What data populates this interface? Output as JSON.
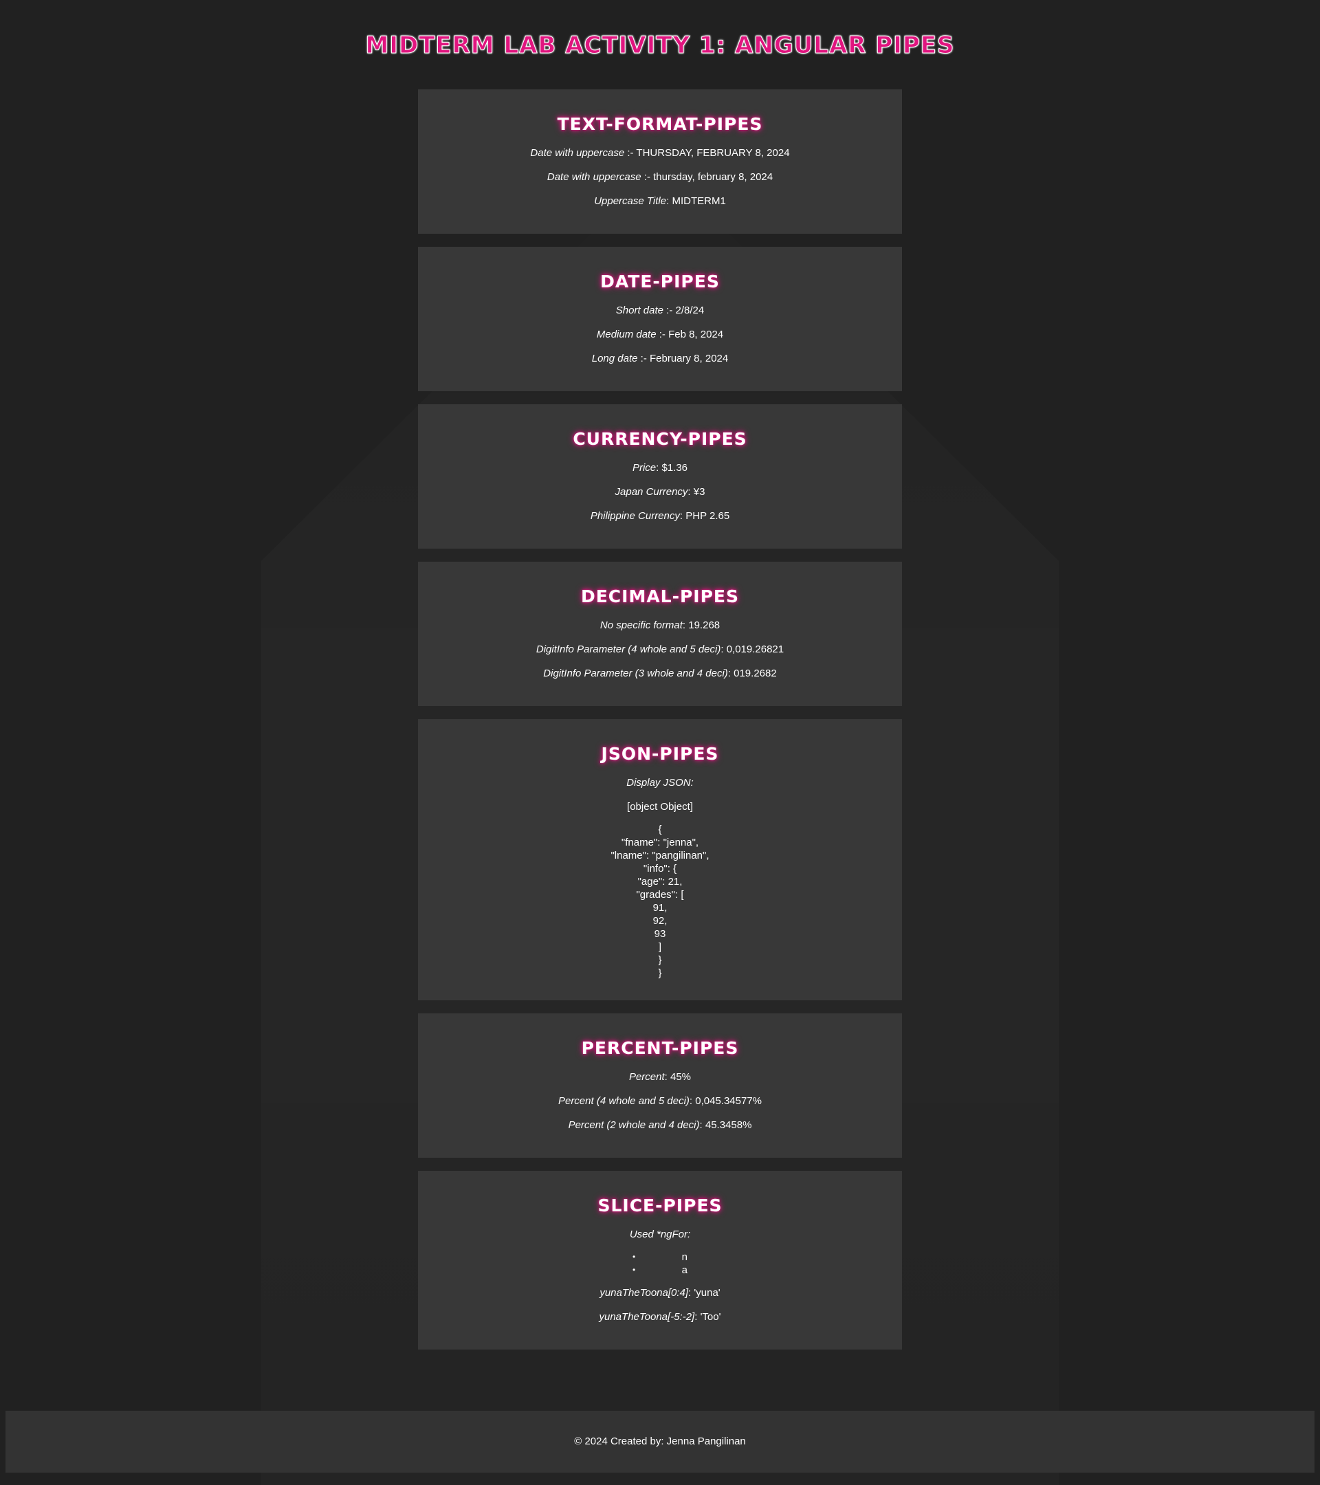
{
  "page": {
    "title": "MIDTERM LAB ACTIVITY 1: ANGULAR PIPES"
  },
  "cards": {
    "text_format": {
      "title": "TEXT-FORMAT-PIPES",
      "rows": [
        {
          "label": "Date with uppercase",
          "sep": " :- ",
          "value": "THURSDAY, FEBRUARY 8, 2024"
        },
        {
          "label": "Date with uppercase",
          "sep": " :- ",
          "value": "thursday, february 8, 2024"
        },
        {
          "label": "Uppercase Title",
          "sep": ": ",
          "value": "MIDTERM1"
        }
      ]
    },
    "date": {
      "title": "DATE-PIPES",
      "rows": [
        {
          "label": "Short date",
          "sep": " :- ",
          "value": "2/8/24"
        },
        {
          "label": "Medium date",
          "sep": " :- ",
          "value": "Feb 8, 2024"
        },
        {
          "label": "Long date",
          "sep": " :- ",
          "value": "February 8, 2024"
        }
      ]
    },
    "currency": {
      "title": "CURRENCY-PIPES",
      "rows": [
        {
          "label": "Price",
          "sep": ": ",
          "value": "$1.36"
        },
        {
          "label": "Japan Currency",
          "sep": ": ",
          "value": "¥3"
        },
        {
          "label": "Philippine Currency",
          "sep": ": ",
          "value": "PHP 2.65"
        }
      ]
    },
    "decimal": {
      "title": "DECIMAL-PIPES",
      "rows": [
        {
          "label": "No specific format",
          "sep": ": ",
          "value": "19.268"
        },
        {
          "label": "DigitInfo Parameter (4 whole and 5 deci)",
          "sep": ": ",
          "value": "0,019.26821"
        },
        {
          "label": "DigitInfo Parameter (3 whole and 4 deci)",
          "sep": ": ",
          "value": "019.2682"
        }
      ]
    },
    "json": {
      "title": "JSON-PIPES",
      "label": "Display JSON:",
      "object_text": "[object Object]",
      "json_text": "{\n\"fname\": \"jenna\",\n\"lname\": \"pangilinan\",\n\"info\": {\n\"age\": 21,\n\"grades\": [\n91,\n92,\n93\n]\n}\n}"
    },
    "percent": {
      "title": "PERCENT-PIPES",
      "rows": [
        {
          "label": "Percent",
          "sep": ": ",
          "value": "45%"
        },
        {
          "label": "Percent (4 whole and 5 deci)",
          "sep": ": ",
          "value": "0,045.34577%"
        },
        {
          "label": "Percent (2 whole and 4 deci)",
          "sep": ": ",
          "value": "45.3458%"
        }
      ]
    },
    "slice": {
      "title": "SLICE-PIPES",
      "label": "Used *ngFor:",
      "bullet": "•",
      "items": [
        "n",
        "a"
      ],
      "rows": [
        {
          "label": "yunaTheToona[0:4]",
          "sep": ": ",
          "value": "'yuna'"
        },
        {
          "label": "yunaTheToona[-5:-2]",
          "sep": ": ",
          "value": "'Too'"
        }
      ]
    }
  },
  "footer": {
    "text": "© 2024 Created by: Jenna Pangilinan"
  }
}
